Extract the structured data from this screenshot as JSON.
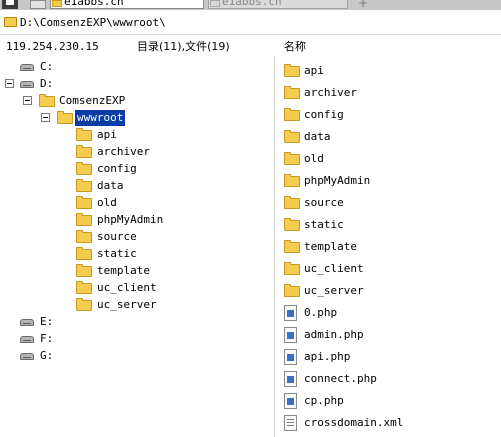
{
  "tabs": [
    {
      "label": "e1abbs.cn",
      "active": true
    },
    {
      "label": "e1abbs.cn",
      "active": false
    }
  ],
  "address": "D:\\ComsenzEXP\\wwwroot\\",
  "header": {
    "ip": "119.254.230.15",
    "summary": "目录(11),文件(19)",
    "name_column": "名称"
  },
  "tree": {
    "drive_c": "C:",
    "drive_d": "D:",
    "comsenzexp": "ComsenzEXP",
    "wwwroot": "wwwroot",
    "folders": [
      "api",
      "archiver",
      "config",
      "data",
      "old",
      "phpMyAdmin",
      "source",
      "static",
      "template",
      "uc_client",
      "uc_server"
    ],
    "drive_e": "E:",
    "drive_f": "F:",
    "drive_g": "G:"
  },
  "list": {
    "folders": [
      "api",
      "archiver",
      "config",
      "data",
      "old",
      "phpMyAdmin",
      "source",
      "static",
      "template",
      "uc_client",
      "uc_server"
    ],
    "files": [
      {
        "name": "0.php",
        "type": "php"
      },
      {
        "name": "admin.php",
        "type": "php"
      },
      {
        "name": "api.php",
        "type": "php"
      },
      {
        "name": "connect.php",
        "type": "php"
      },
      {
        "name": "cp.php",
        "type": "php"
      },
      {
        "name": "crossdomain.xml",
        "type": "xml"
      }
    ]
  },
  "colors": {
    "selection": "#0a3ea6",
    "folder": "#f4cd4e",
    "tabstrip": "#c8c8c8"
  },
  "icons": {
    "folder": "folder-icon",
    "drive": "drive-icon",
    "php_file": "php-file-icon",
    "xml_file": "xml-file-icon",
    "expander": "collapse-toggle-icon"
  }
}
